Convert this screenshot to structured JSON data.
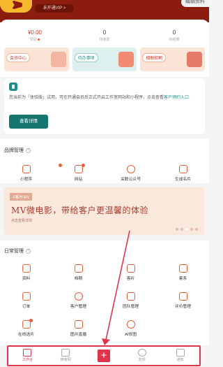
{
  "header": {
    "vip_badge": "未开通VIP >",
    "edit_button": "编辑资料"
  },
  "stats": [
    {
      "value": "¥0.00",
      "label": "赞助",
      "red": true
    },
    {
      "value": "0",
      "label": "待收款"
    },
    {
      "value": "0",
      "label": "待结算"
    }
  ],
  "tiles": [
    {
      "label": "会员中心"
    },
    {
      "label": "待办事项"
    },
    {
      "label": "相册印刷"
    }
  ],
  "trial": {
    "text": "您当前为「体验版」试用，可在开通会员后正式开启工作室网站和小程序，点击查看",
    "link": "客户预约入口",
    "button": "查看详情"
  },
  "brand": {
    "title": "品牌管理",
    "items": [
      {
        "label": "小程序",
        "dot": true,
        "icon": "link-icon"
      },
      {
        "label": "网站",
        "dot": true,
        "icon": "monitor-icon"
      },
      {
        "label": "关联公众号",
        "icon": "user-icon"
      },
      {
        "label": "生成名片",
        "icon": "card-icon"
      }
    ]
  },
  "banner": {
    "tag": "#客片MV",
    "title": "MV微电影，带给客户更温馨的体验",
    "sub": "点击查看详情"
  },
  "daily": {
    "title": "日常管理",
    "rows": [
      [
        {
          "label": "资料",
          "icon": "document-icon"
        },
        {
          "label": "档期",
          "icon": "calendar-icon"
        },
        {
          "label": "客片",
          "icon": "photo-icon"
        },
        {
          "label": "套系",
          "icon": "package-icon"
        }
      ],
      [
        {
          "label": "订单",
          "icon": "order-icon"
        },
        {
          "label": "客户管理",
          "icon": "customer-icon"
        },
        {
          "label": "团队管理",
          "icon": "team-icon"
        },
        {
          "label": "评价管理",
          "icon": "review-icon"
        }
      ],
      [
        {
          "label": "在线选片",
          "icon": "select-photo-icon",
          "dot": true
        },
        {
          "label": "图片直播",
          "icon": "live-icon"
        },
        {
          "label": "AI修图",
          "icon": "ai-retouch-icon"
        }
      ]
    ]
  },
  "tabbar": [
    {
      "label": "工作台",
      "icon": "monitor-icon",
      "active": true
    },
    {
      "label": "微官网",
      "icon": "home-icon"
    },
    {
      "label": "",
      "icon": "plus-icon"
    },
    {
      "label": "发现",
      "icon": "compass-icon"
    },
    {
      "label": "通知",
      "icon": "bell-icon"
    }
  ],
  "colors": {
    "header_bg": "#8c1c0e",
    "accent": "#e5603f",
    "trial_button": "#15756f",
    "highlight": "#e0344d"
  }
}
